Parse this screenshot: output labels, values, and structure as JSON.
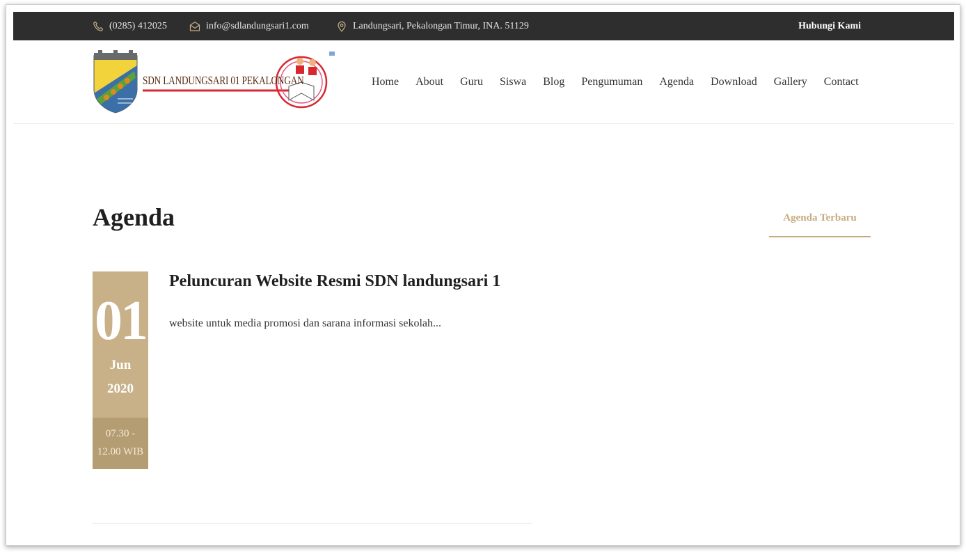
{
  "topbar": {
    "phone": "(0285) 412025",
    "email": "info@sdlandungsari1.com",
    "address": "Landungsari, Pekalongan Timur, INA. 51129",
    "contact_link": "Hubungi Kami"
  },
  "header": {
    "logo_text": "SDN LANDUNGSARI 01 PEKALONGAN",
    "nav": [
      "Home",
      "About",
      "Guru",
      "Siswa",
      "Blog",
      "Pengumuman",
      "Agenda",
      "Download",
      "Gallery",
      "Contact"
    ]
  },
  "main": {
    "page_title": "Agenda",
    "agenda": {
      "day": "01",
      "month": "Jun",
      "year": "2020",
      "time_line1": "07.30 -",
      "time_line2": "12.00 WIB",
      "title": "Peluncuran Website Resmi SDN landungsari 1",
      "excerpt": "website untuk media promosi dan sarana informasi sekolah..."
    }
  },
  "sidebar": {
    "title": "Agenda Terbaru"
  },
  "colors": {
    "accent": "#c8b088",
    "accent_dark": "#b59d73",
    "topbar_bg": "#2e2e2e"
  },
  "icons": {
    "phone": "phone-icon",
    "email": "envelope-icon",
    "address": "map-pin-icon"
  }
}
